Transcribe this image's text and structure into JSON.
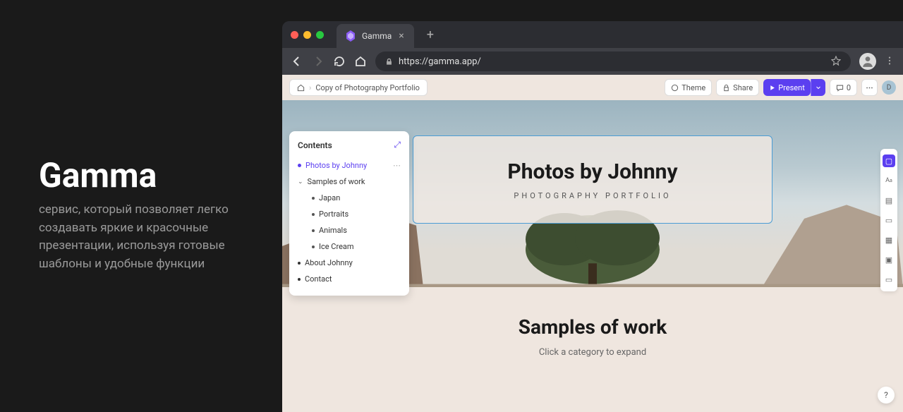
{
  "left": {
    "title": "Gamma",
    "description": "сервис, который позволяет легко создавать яркие и красочные презентации, используя готовые шаблоны и удобные функции"
  },
  "browser": {
    "tab_title": "Gamma",
    "url": "https://gamma.app/"
  },
  "app": {
    "breadcrumb": "Copy of Photography Portfolio",
    "theme_btn": "Theme",
    "share_btn": "Share",
    "present_btn": "Present",
    "comment_count": "0",
    "user_initial": "D"
  },
  "hero": {
    "title": "Photos by Johnny",
    "subtitle": "PHOTOGRAPHY PORTFOLIO"
  },
  "samples": {
    "title": "Samples of work",
    "subtitle": "Click a category to expand"
  },
  "contents": {
    "header": "Contents",
    "items": [
      {
        "label": "Photos by Johnny",
        "active": true,
        "type": "bullet",
        "more": true
      },
      {
        "label": "Samples of work",
        "type": "chevron"
      },
      {
        "label": "Japan",
        "type": "sub"
      },
      {
        "label": "Portraits",
        "type": "sub"
      },
      {
        "label": "Animals",
        "type": "sub"
      },
      {
        "label": "Ice Cream",
        "type": "sub"
      },
      {
        "label": "About Johnny",
        "type": "bullet"
      },
      {
        "label": "Contact",
        "type": "bullet"
      }
    ]
  },
  "help": "?"
}
